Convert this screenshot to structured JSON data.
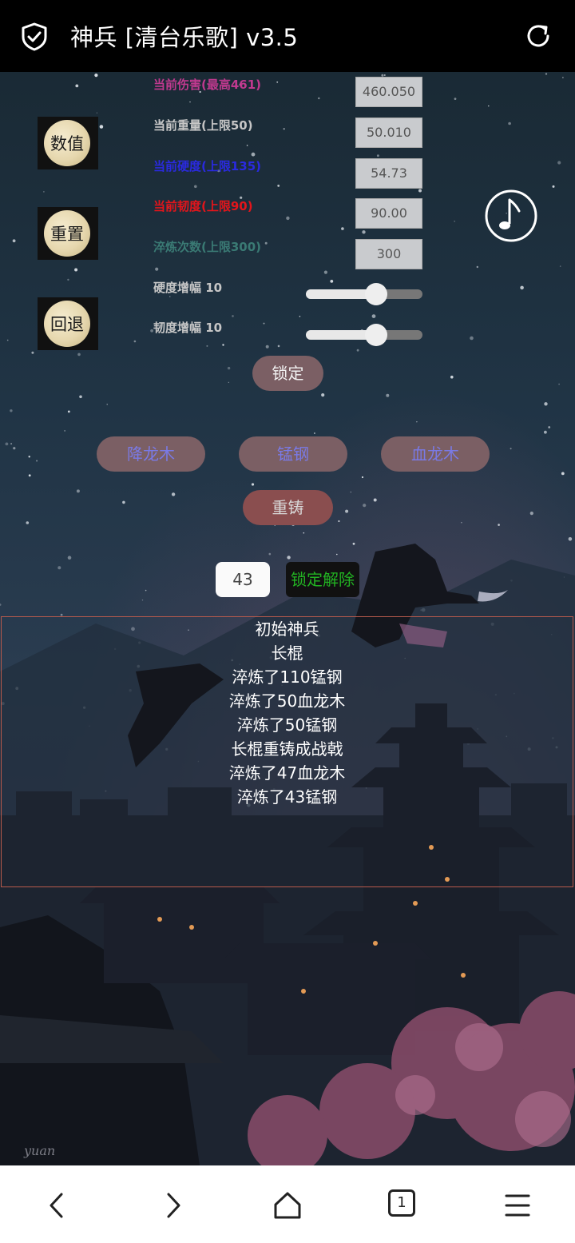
{
  "topbar": {
    "title": "神兵 [清台乐歌] v3.5",
    "left_icon": "shield-check-icon",
    "right_icon": "reload-icon"
  },
  "side_buttons": [
    {
      "label": "数值"
    },
    {
      "label": "重置"
    },
    {
      "label": "回退"
    }
  ],
  "stats": [
    {
      "label": "当前伤害(最高461)",
      "value": "460.050",
      "color": "#c0398f"
    },
    {
      "label": "当前重量(上限50)",
      "value": "50.010",
      "color": "#c6c6c6"
    },
    {
      "label": "当前硬度(上限135)",
      "value": "54.73",
      "color": "#2a2ae0"
    },
    {
      "label": "当前韧度(上限90)",
      "value": "90.00",
      "color": "#e3151b"
    },
    {
      "label": "淬炼次数(上限300)",
      "value": "300",
      "color": "#3a7a74"
    }
  ],
  "sliders": [
    {
      "label": "硬度增幅 10",
      "level": 0.6
    },
    {
      "label": "韧度增幅 10",
      "level": 0.6
    }
  ],
  "music_icon": "music-note-icon",
  "lock_button": {
    "label": "锁定",
    "color": "#f2f2f2"
  },
  "materials": [
    {
      "label": "降龙木",
      "color": "#7a7ae6"
    },
    {
      "label": "锰钢",
      "color": "#7a7ae6"
    },
    {
      "label": "血龙木",
      "color": "#7a7ae6"
    }
  ],
  "recast_button": {
    "label": "重铸",
    "color": "#d8d8d8"
  },
  "count_input": {
    "value": "43"
  },
  "unlock_button": {
    "label": "锁定解除"
  },
  "log": [
    "初始神兵",
    "长棍",
    "淬炼了110锰钢",
    "淬炼了50血龙木",
    "淬炼了50锰钢",
    "长棍重铸成战戟",
    "淬炼了47血龙木",
    "淬炼了43锰钢"
  ],
  "watermark": "yuan",
  "navbar": {
    "icons": [
      "back-icon",
      "forward-icon",
      "home-icon",
      "tabs-icon",
      "menu-icon"
    ],
    "tab_count": "1"
  }
}
